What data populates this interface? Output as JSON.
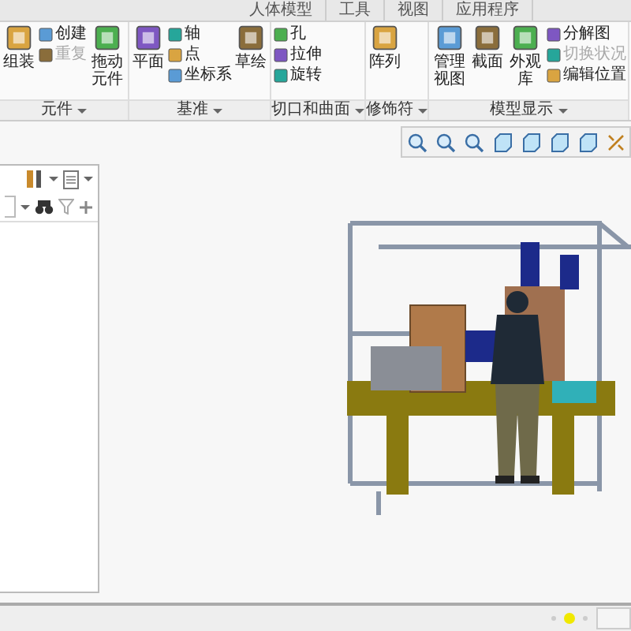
{
  "tabs": [
    {
      "label": "人体模型",
      "selected": false
    },
    {
      "label": "工具",
      "selected": false
    },
    {
      "label": "视图",
      "selected": false
    },
    {
      "label": "应用程序",
      "selected": false
    }
  ],
  "groups": [
    {
      "label": "元件",
      "columns": [
        [
          {
            "kind": "large",
            "label": "组装",
            "disabled": false
          }
        ],
        [
          {
            "kind": "small",
            "label": "创建",
            "disabled": false
          },
          {
            "kind": "small",
            "label": "重复",
            "disabled": true
          }
        ],
        [
          {
            "kind": "large",
            "label": "拖动元件",
            "disabled": false
          }
        ]
      ]
    },
    {
      "label": "基准",
      "columns": [
        [
          {
            "kind": "large",
            "label": "平面",
            "disabled": false
          }
        ],
        [
          {
            "kind": "small",
            "label": "轴",
            "disabled": false
          },
          {
            "kind": "small",
            "label": "点",
            "disabled": false
          },
          {
            "kind": "small",
            "label": "坐标系",
            "disabled": false
          }
        ],
        [
          {
            "kind": "large",
            "label": "草绘",
            "disabled": false
          }
        ]
      ]
    },
    {
      "label": "切口和曲面",
      "columns": [
        [
          {
            "kind": "small",
            "label": "孔",
            "disabled": false
          },
          {
            "kind": "small",
            "label": "拉伸",
            "disabled": false
          },
          {
            "kind": "small",
            "label": "旋转",
            "disabled": false
          }
        ]
      ]
    },
    {
      "label": "修饰符",
      "columns": [
        [
          {
            "kind": "large",
            "label": "阵列",
            "disabled": false
          }
        ]
      ]
    },
    {
      "label": "模型显示",
      "columns": [
        [
          {
            "kind": "large",
            "label": "管理视图",
            "disabled": false
          }
        ],
        [
          {
            "kind": "large",
            "label": "截面",
            "disabled": false
          }
        ],
        [
          {
            "kind": "large",
            "label": "外观库",
            "disabled": false
          }
        ],
        [
          {
            "kind": "small",
            "label": "分解图",
            "disabled": false
          },
          {
            "kind": "small",
            "label": "切换状况",
            "disabled": true
          },
          {
            "kind": "small",
            "label": "编辑位置",
            "disabled": false
          }
        ]
      ]
    }
  ]
}
